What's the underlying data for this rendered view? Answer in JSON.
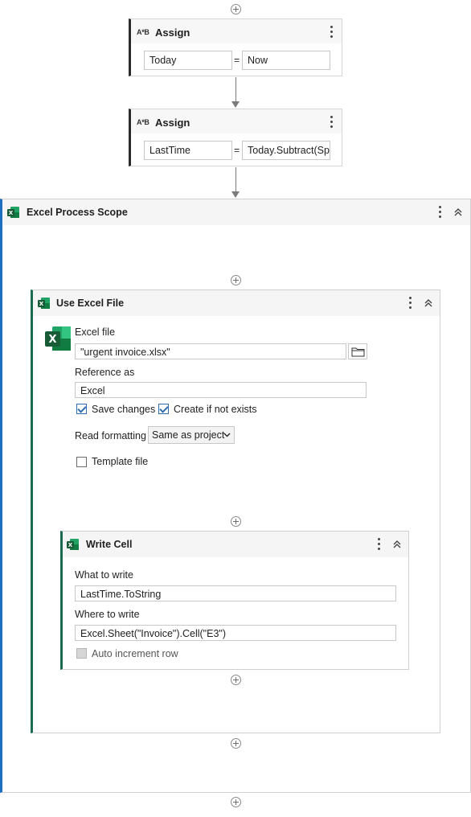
{
  "assign1": {
    "title": "Assign",
    "icon": "A*B",
    "target": "Today",
    "eq": "=",
    "value": "Now"
  },
  "assign2": {
    "title": "Assign",
    "icon": "A*B",
    "target": "LastTime",
    "eq": "=",
    "value": "Today.Subtract(Sp"
  },
  "process_scope": {
    "title": "Excel Process Scope"
  },
  "use_excel": {
    "title": "Use Excel File",
    "excel_file_label": "Excel file",
    "excel_file_value": "\"urgent invoice.xlsx\"",
    "reference_label": "Reference as",
    "reference_value": "Excel",
    "save_changes": "Save changes",
    "create_if_not_exists": "Create if not exists",
    "read_formatting_label": "Read formatting",
    "read_formatting_value": "Same as project",
    "template_file": "Template file"
  },
  "write_cell": {
    "title": "Write Cell",
    "what_label": "What to write",
    "what_value": "LastTime.ToString",
    "where_label": "Where to write",
    "where_value": "Excel.Sheet(\"Invoice\").Cell(\"E3\")",
    "auto_increment": "Auto increment row"
  },
  "colors": {
    "excel_green": "#1d6f42",
    "scope_bar_blue": "#1f6fc0",
    "scope_bar_green": "#1b6b4e",
    "check_blue": "#2f6db5"
  },
  "icons": [
    "plus-circle-icon",
    "arrow-down-icon",
    "kebab-icon",
    "collapse-chevron-icon",
    "excel-icon",
    "folder-icon",
    "dropdown-chevron-icon",
    "checkbox-icon"
  ]
}
